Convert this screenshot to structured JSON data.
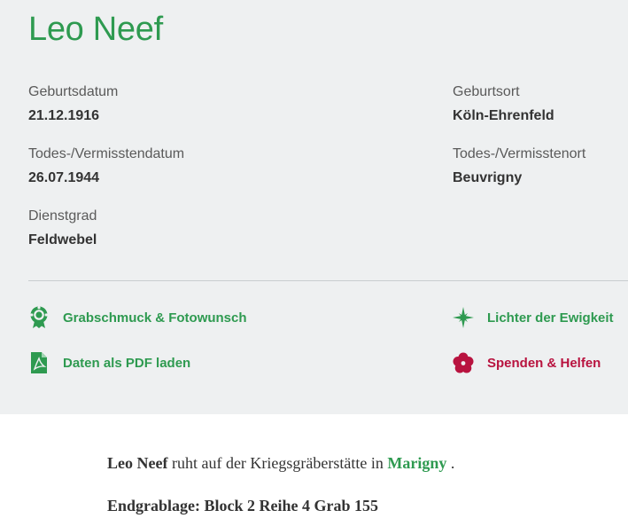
{
  "person": {
    "name": "Leo Neef"
  },
  "details": {
    "birth_date_label": "Geburtsdatum",
    "birth_date": "21.12.1916",
    "birth_place_label": "Geburtsort",
    "birth_place": "Köln-Ehrenfeld",
    "death_date_label": "Todes-/Vermisstendatum",
    "death_date": "26.07.1944",
    "death_place_label": "Todes-/Vermisstenort",
    "death_place": "Beuvrigny",
    "rank_label": "Dienstgrad",
    "rank": "Feldwebel"
  },
  "actions": {
    "grave_decoration": "Grabschmuck & Fotowunsch",
    "lights": "Lichter der Ewigkeit",
    "pdf": "Daten als PDF laden",
    "donate": "Spenden & Helfen"
  },
  "burial": {
    "name": "Leo Neef",
    "text_rest": " ruht auf der Kriegsgräberstätte in ",
    "cemetery": "Marigny",
    "period": " .",
    "final_grave": "Endgrablage: Block 2 Reihe 4 Grab 155"
  },
  "colors": {
    "accent_green": "#2e9a50",
    "accent_red": "#b8133f",
    "panel_bg": "#eef0f1"
  },
  "icons": {
    "grave_decoration": "wreath-icon",
    "lights": "star-icon",
    "pdf": "pdf-file-icon",
    "donate": "flower-icon"
  }
}
